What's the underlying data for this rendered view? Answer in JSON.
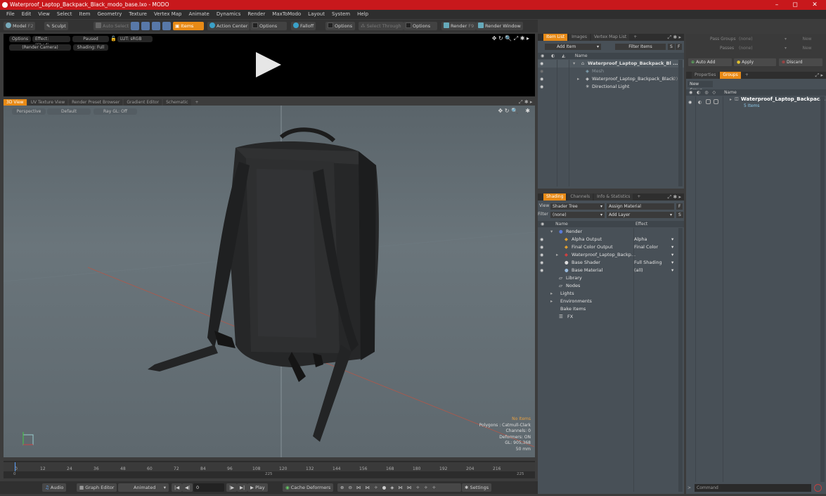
{
  "window": {
    "title": "Waterproof_Laptop_Backpack_Black_modo_base.lxo - MODO",
    "minimize": "–",
    "restore": "◻",
    "close": "✕"
  },
  "menu": [
    "File",
    "Edit",
    "View",
    "Select",
    "Item",
    "Geometry",
    "Texture",
    "Vertex Map",
    "Animate",
    "Dynamics",
    "Render",
    "MaxToModo",
    "Layout",
    "System",
    "Help"
  ],
  "toolbar": {
    "model": "Model",
    "f2": "F2",
    "sculpt": "Sculpt",
    "auto_select": "Auto Select",
    "items": "Items",
    "action_center": "Action Center",
    "options1": "Options",
    "falloff": "Falloff",
    "options2": "Options",
    "select_through": "Select Through",
    "options3": "Options",
    "render": "Render",
    "f9": "F9",
    "render_window": "Render Window"
  },
  "preview": {
    "options": "Options",
    "effect": "Effect: (Shadi...",
    "paused": "Paused",
    "lut": "LUT: sRGB",
    "camera": "(Render Camera)",
    "shading": "Shading: Full"
  },
  "viewport_tabs": [
    "3D View",
    "UV Texture View",
    "Render Preset Browser",
    "Gradient Editor",
    "Schematic",
    "+"
  ],
  "viewport": {
    "perspective": "Perspective",
    "default": "Default",
    "raygl": "Ray GL: Off"
  },
  "hud": {
    "no_items": "No Items",
    "polygons": "Polygons : Catmull-Clark",
    "channels": "Channels: 0",
    "deformers": "Deformers: ON",
    "gl": "GL: 905,368",
    "mm": "50 mm"
  },
  "timeline": {
    "ticks": [
      "0",
      "12",
      "24",
      "36",
      "48",
      "60",
      "72",
      "84",
      "96",
      "108",
      "120",
      "132",
      "144",
      "156",
      "168",
      "180",
      "192",
      "204",
      "216"
    ],
    "start": "0",
    "mid": "225",
    "end": "225"
  },
  "bottom": {
    "audio": "Audio",
    "graph_editor": "Graph Editor",
    "animated": "Animated",
    "frame": "0",
    "play": "Play",
    "cache_deformers": "Cache Deformers",
    "settings": "Settings"
  },
  "itemlist": {
    "tabs": [
      "Item List",
      "Images",
      "Vertex Map List",
      "+"
    ],
    "add_item": "Add Item",
    "filter_items": "Filter Items",
    "s": "S",
    "f": "F",
    "col_name": "Name",
    "rows": [
      {
        "label": "Waterproof_Laptop_Backpack_Bl ...",
        "bold": true
      },
      {
        "label": "Mesh",
        "dim": true
      },
      {
        "label": "Waterproof_Laptop_Backpack_Black",
        "suffix": "(2)"
      },
      {
        "label": "Directional Light"
      }
    ]
  },
  "shading": {
    "tabs": [
      "Shading",
      "Channels",
      "Info & Statistics",
      "+"
    ],
    "view_label": "View",
    "view_value": "Shader Tree",
    "assign_material": "Assign Material",
    "f": "F",
    "filter_label": "Filter",
    "filter_value": "(none)",
    "add_layer": "Add Layer",
    "s": "S",
    "col_name": "Name",
    "col_effect": "Effect",
    "rows": [
      {
        "name": "Render",
        "effect": ""
      },
      {
        "name": "Alpha Output",
        "effect": "Alpha"
      },
      {
        "name": "Final Color Output",
        "effect": "Final Color"
      },
      {
        "name": "Waterproof_Laptop_Backp...",
        "effect": ""
      },
      {
        "name": "Base Shader",
        "effect": "Full Shading"
      },
      {
        "name": "Base Material",
        "effect": "(all)"
      },
      {
        "name": "Library",
        "effect": ""
      },
      {
        "name": "Nodes",
        "effect": ""
      },
      {
        "name": "Lights",
        "effect": ""
      },
      {
        "name": "Environments",
        "effect": ""
      },
      {
        "name": "Bake Items",
        "effect": ""
      },
      {
        "name": "FX",
        "effect": ""
      }
    ]
  },
  "groups": {
    "pass_groups": "Pass Groups",
    "passes": "Passes",
    "none": "(none)",
    "new": "New",
    "auto_add": "Auto Add",
    "apply": "Apply",
    "discard": "Discard",
    "tabs": [
      "Properties",
      "Groups",
      "+"
    ],
    "new_group": "New Group",
    "col_name": "Name",
    "group_name": "Waterproof_Laptop_Backpac...",
    "group_count": "5 Items",
    "command": "Command"
  },
  "colors": {
    "accent": "#e88a16",
    "title": "#c8181c"
  }
}
